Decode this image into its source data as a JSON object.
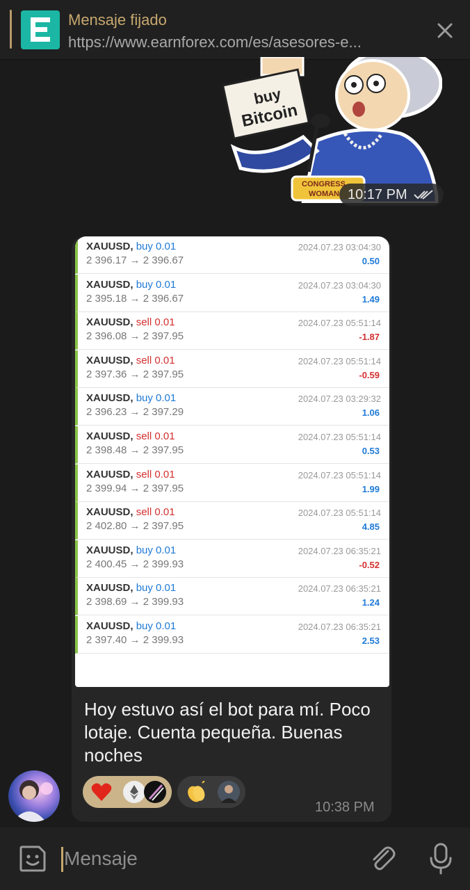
{
  "pinned": {
    "title": "Mensaje fijado",
    "url": "https://www.earnforex.com/es/asesores-e..."
  },
  "sticker": {
    "sign_line1": "buy",
    "sign_line2": "Bitcoin",
    "badge_line1": "CONGRESS",
    "badge_line2": "WOMAN",
    "time": "10:17 PM"
  },
  "trades": [
    {
      "symbol": "XAUUSD,",
      "side": "buy",
      "volume": "0.01",
      "prices": "2 396.17 → 2 396.67",
      "date": "2024.07.23 03:04:30",
      "profit": "0.50"
    },
    {
      "symbol": "XAUUSD,",
      "side": "buy",
      "volume": "0.01",
      "prices": "2 395.18 → 2 396.67",
      "date": "2024.07.23 03:04:30",
      "profit": "1.49"
    },
    {
      "symbol": "XAUUSD,",
      "side": "sell",
      "volume": "0.01",
      "prices": "2 396.08 → 2 397.95",
      "date": "2024.07.23 05:51:14",
      "profit": "-1.87"
    },
    {
      "symbol": "XAUUSD,",
      "side": "sell",
      "volume": "0.01",
      "prices": "2 397.36 → 2 397.95",
      "date": "2024.07.23 05:51:14",
      "profit": "-0.59"
    },
    {
      "symbol": "XAUUSD,",
      "side": "buy",
      "volume": "0.01",
      "prices": "2 396.23 → 2 397.29",
      "date": "2024.07.23 03:29:32",
      "profit": "1.06"
    },
    {
      "symbol": "XAUUSD,",
      "side": "sell",
      "volume": "0.01",
      "prices": "2 398.48 → 2 397.95",
      "date": "2024.07.23 05:51:14",
      "profit": "0.53"
    },
    {
      "symbol": "XAUUSD,",
      "side": "sell",
      "volume": "0.01",
      "prices": "2 399.94 → 2 397.95",
      "date": "2024.07.23 05:51:14",
      "profit": "1.99"
    },
    {
      "symbol": "XAUUSD,",
      "side": "sell",
      "volume": "0.01",
      "prices": "2 402.80 → 2 397.95",
      "date": "2024.07.23 05:51:14",
      "profit": "4.85"
    },
    {
      "symbol": "XAUUSD,",
      "side": "buy",
      "volume": "0.01",
      "prices": "2 400.45 → 2 399.93",
      "date": "2024.07.23 06:35:21",
      "profit": "-0.52"
    },
    {
      "symbol": "XAUUSD,",
      "side": "buy",
      "volume": "0.01",
      "prices": "2 398.69 → 2 399.93",
      "date": "2024.07.23 06:35:21",
      "profit": "1.24"
    },
    {
      "symbol": "XAUUSD,",
      "side": "buy",
      "volume": "0.01",
      "prices": "2 397.40 → 2 399.93",
      "date": "2024.07.23 06:35:21",
      "profit": "2.53"
    }
  ],
  "message": {
    "text": "Hoy estuvo así el bot para mí. Poco lotaje. Cuenta pequeña. Buenas noches",
    "time": "10:38 PM",
    "reactions": [
      {
        "emoji": "heart-icon",
        "count_avatars": 2
      },
      {
        "emoji": "clap-icon",
        "count_avatars": 1
      }
    ]
  },
  "composer": {
    "placeholder": "Mensaje"
  },
  "colors": {
    "background": "#1b1b1b",
    "accent": "#c7a86f",
    "buy": "#1f7ad6",
    "sell": "#d32f2f",
    "trade_bar": "#8bc34a"
  }
}
